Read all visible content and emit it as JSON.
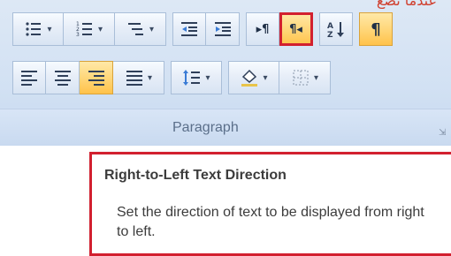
{
  "top_fragment": "عندما تضع",
  "ribbon": {
    "group_label": "Paragraph",
    "launcher_icon": "dialog-launcher-icon",
    "row1": [
      {
        "name": "bullets",
        "icon": "bullets-icon",
        "split": true
      },
      {
        "name": "numbering",
        "icon": "numbering-icon",
        "split": true
      },
      {
        "name": "multilevel-list",
        "icon": "multilevel-list-icon",
        "split": true
      },
      {
        "name": "decrease-indent",
        "icon": "decrease-indent-icon"
      },
      {
        "name": "increase-indent",
        "icon": "increase-indent-icon"
      },
      {
        "name": "left-to-right",
        "icon": "ltr-text-icon"
      },
      {
        "name": "right-to-left",
        "icon": "rtl-text-icon",
        "highlighted": true,
        "selected": true
      },
      {
        "name": "sort",
        "icon": "sort-az-icon"
      },
      {
        "name": "show-hide",
        "icon": "pilcrow-icon",
        "highlighted": true
      }
    ],
    "row2": [
      {
        "name": "align-left",
        "icon": "align-left-icon"
      },
      {
        "name": "center",
        "icon": "align-center-icon"
      },
      {
        "name": "align-right",
        "icon": "align-right-icon",
        "highlighted": true
      },
      {
        "name": "justify",
        "icon": "justify-icon",
        "split": true
      },
      {
        "name": "line-spacing",
        "icon": "line-spacing-icon",
        "split": true
      },
      {
        "name": "shading",
        "icon": "shading-bucket-icon",
        "split": true
      },
      {
        "name": "borders",
        "icon": "borders-icon",
        "split": true
      }
    ]
  },
  "tooltip": {
    "title": "Right-to-Left Text Direction",
    "body": "Set the direction of text to be displayed from right to left."
  },
  "colors": {
    "highlight": "#ffc24a",
    "selection_outline": "#d2202f",
    "ribbon_bg": "#d2e1f3"
  }
}
